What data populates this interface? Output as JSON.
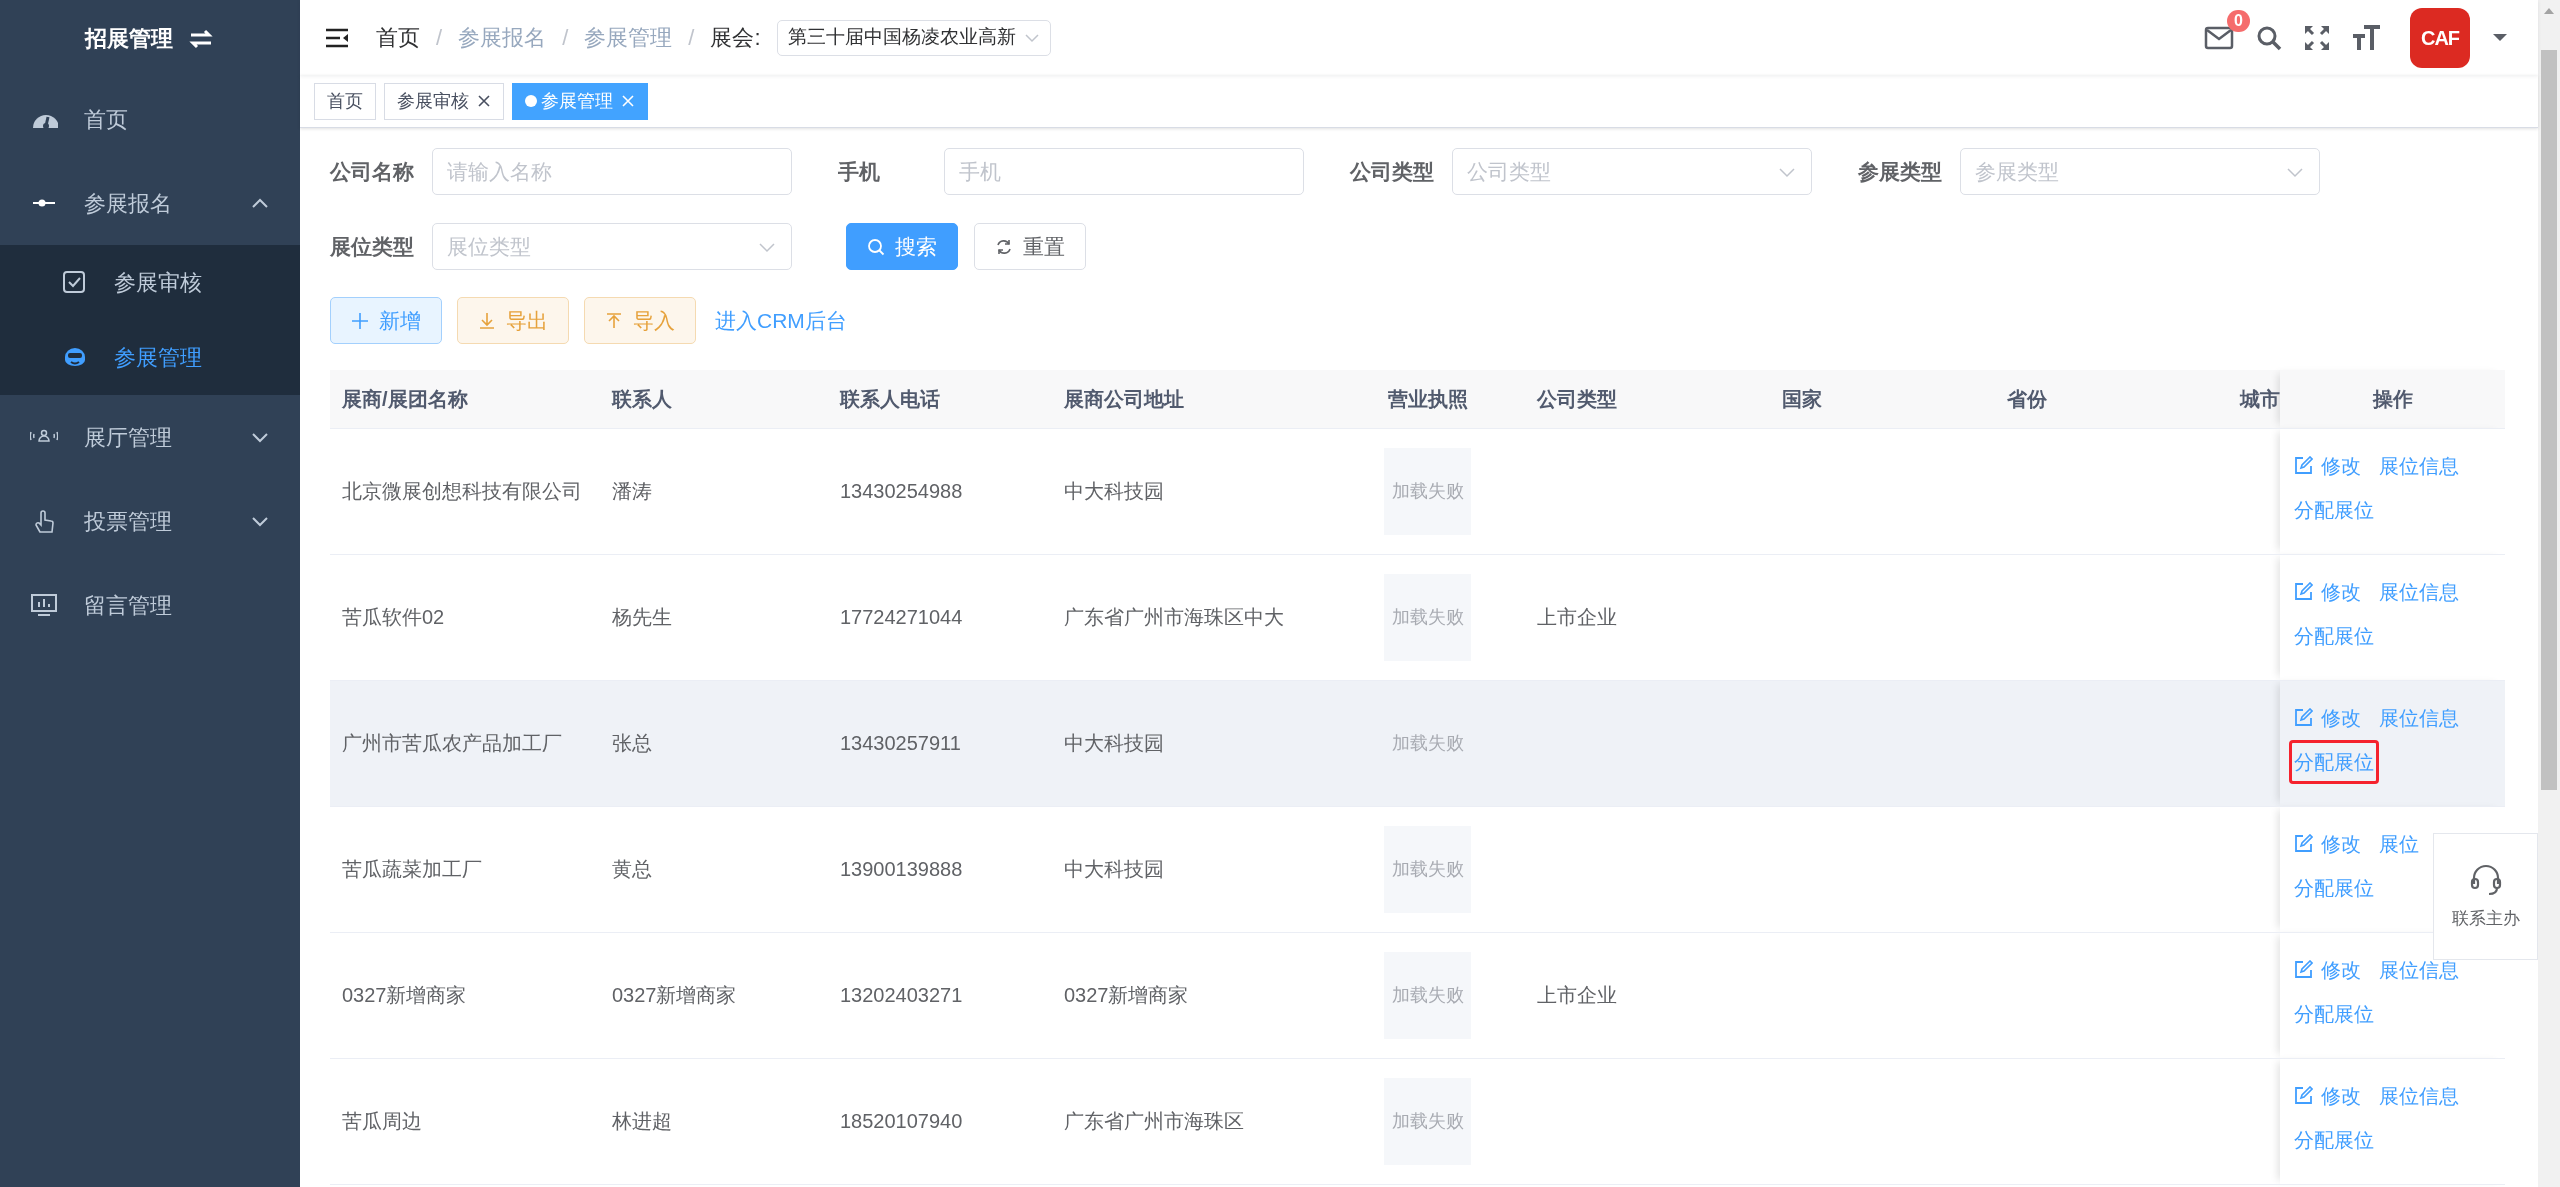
{
  "sidebar": {
    "title": "招展管理",
    "items": [
      {
        "label": "首页",
        "selected": false
      },
      {
        "label": "参展报名",
        "selected": false,
        "expanded": true,
        "children": [
          {
            "label": "参展审核",
            "selected": false
          },
          {
            "label": "参展管理",
            "selected": true
          }
        ]
      },
      {
        "label": "展厅管理",
        "selected": false,
        "expanded": false
      },
      {
        "label": "投票管理",
        "selected": false,
        "expanded": false
      },
      {
        "label": "留言管理",
        "selected": false
      }
    ]
  },
  "header": {
    "breadcrumbs": [
      {
        "label": "首页",
        "kind": "link"
      },
      {
        "separator": "/",
        "label": "参展报名",
        "kind": "text"
      },
      {
        "separator": "/",
        "label": "参展管理",
        "kind": "text"
      }
    ],
    "event_separator": "/",
    "event_label": "展会:",
    "event_value": "第三十届中国杨凌农业高新",
    "mail_badge": "0",
    "avatar_text": "CAF"
  },
  "tags": [
    {
      "label": "首页",
      "selected": false,
      "closable": false
    },
    {
      "label": "参展审核",
      "selected": false,
      "closable": true
    },
    {
      "label": "参展管理",
      "selected": true,
      "closable": true
    }
  ],
  "filters": [
    {
      "label": "公司名称",
      "placeholder": "请输入名称",
      "kind": "input"
    },
    {
      "label": "手机",
      "placeholder": "手机",
      "kind": "input"
    },
    {
      "label": "公司类型",
      "placeholder": "公司类型",
      "kind": "select"
    },
    {
      "label": "参展类型",
      "placeholder": "参展类型",
      "kind": "select"
    },
    {
      "label": "展位类型",
      "placeholder": "展位类型",
      "kind": "select"
    }
  ],
  "search_button": "搜索",
  "reset_button": "重置",
  "toolbar": [
    {
      "label": "新增",
      "kind": "primary"
    },
    {
      "label": "导出",
      "kind": "warning"
    },
    {
      "label": "导入",
      "kind": "warning"
    }
  ],
  "crm_link": "进入CRM后台",
  "table": {
    "columns": [
      "展商/展团名称",
      "联系人",
      "联系人电话",
      "展商公司地址",
      "营业执照",
      "公司类型",
      "国家",
      "省份",
      "城市",
      "操作"
    ],
    "rows": [
      {
        "name": "北京微展创想科技有限公司",
        "contact": "潘涛",
        "phone": "13430254988",
        "address": "中大科技园",
        "license": "加载失败",
        "hovered": false,
        "edit": "修改",
        "info": "展位信息",
        "assign": "分配展位",
        "highlighted": false
      },
      {
        "name": "苦瓜软件02",
        "contact": "杨先生",
        "phone": "17724271044",
        "address": "广东省广州市海珠区中大",
        "license": "加载失败",
        "company_type": "上市企业",
        "hovered": false,
        "edit": "修改",
        "info": "展位信息",
        "assign": "分配展位",
        "highlighted": false
      },
      {
        "name": "广州市苦瓜农产品加工厂",
        "contact": "张总",
        "phone": "13430257911",
        "address": "中大科技园",
        "license": "加载失败",
        "hovered": true,
        "edit": "修改",
        "info": "展位信息",
        "assign": "分配展位",
        "highlighted": true
      },
      {
        "name": "苦瓜蔬菜加工厂",
        "contact": "黄总",
        "phone": "13900139888",
        "address": "中大科技园",
        "license": "加载失败",
        "hovered": false,
        "edit": "修改",
        "info": "展位",
        "assign": "分配展位",
        "highlighted": false
      },
      {
        "name": "0327新增商家",
        "contact": "0327新增商家",
        "phone": "13202403271",
        "address": "0327新增商家",
        "license": "加载失败",
        "company_type": "上市企业",
        "hovered": false,
        "edit": "修改",
        "info": "展位信息",
        "assign": "分配展位",
        "highlighted": false
      },
      {
        "name": "苦瓜周边",
        "contact": "林进超",
        "phone": "18520107940",
        "address": "广东省广州市海珠区",
        "license": "加载失败",
        "hovered": false,
        "edit": "修改",
        "info": "展位信息",
        "assign": "分配展位",
        "highlighted": false
      }
    ]
  },
  "contact_widget": "联系主办"
}
